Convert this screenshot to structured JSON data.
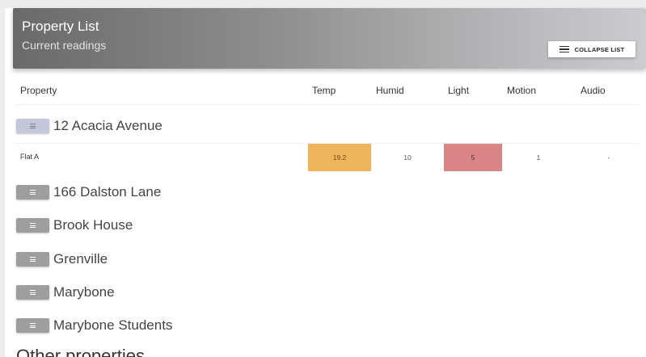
{
  "header": {
    "title": "Property List",
    "subtitle": "Current readings",
    "collapse_label": "COLLAPSE LIST"
  },
  "columns": {
    "property": "Property",
    "temp": "Temp",
    "humid": "Humid",
    "light": "Light",
    "motion": "Motion",
    "audio": "Audio"
  },
  "properties": [
    {
      "name": "12 Acacia Avenue",
      "expanded": true
    },
    {
      "name": "166 Dalston Lane",
      "expanded": false
    },
    {
      "name": "Brook House",
      "expanded": false
    },
    {
      "name": "Grenville",
      "expanded": false
    },
    {
      "name": "Marybone",
      "expanded": false
    },
    {
      "name": "Marybone Students",
      "expanded": false
    }
  ],
  "units": [
    {
      "name": "Flat A",
      "temp": "19.2",
      "humid": "10",
      "light": "5",
      "motion": "1",
      "audio": "-"
    }
  ],
  "other_section": {
    "heading": "Other properties"
  },
  "colors": {
    "temp_highlight": "#efb35a",
    "light_highlight": "#d98585",
    "active_toggle": "#c4c7d8",
    "toggle": "#9e9e9e"
  }
}
